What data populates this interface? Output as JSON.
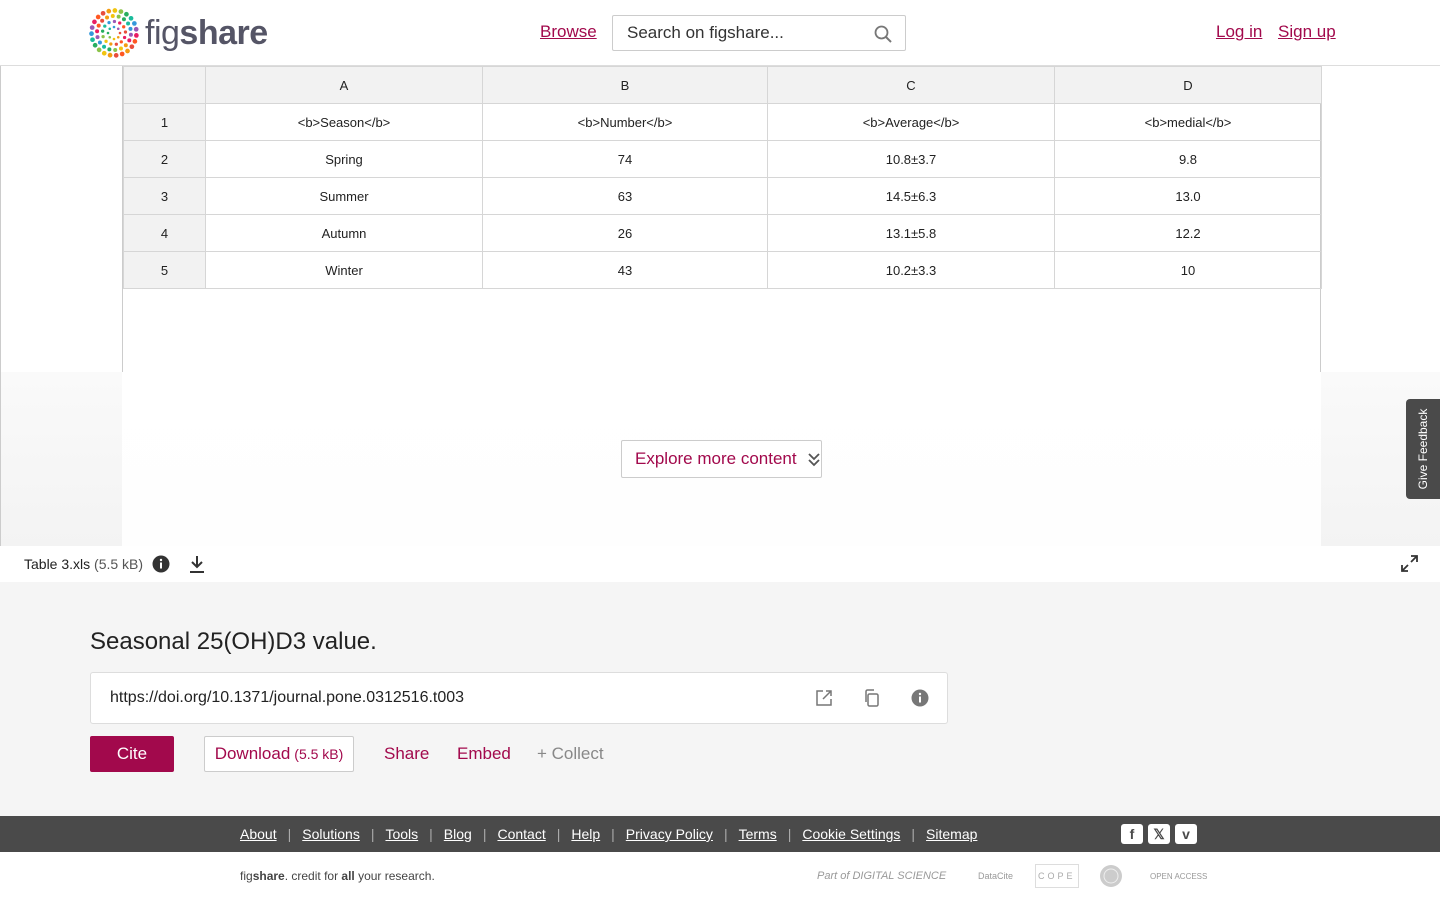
{
  "header": {
    "logo_text_a": "fig",
    "logo_text_b": "share",
    "browse": "Browse",
    "search_placeholder": "Search on figshare...",
    "login": "Log in",
    "signup": "Sign up"
  },
  "sheet": {
    "columns": [
      "A",
      "B",
      "C",
      "D"
    ],
    "rows": [
      {
        "num": "1",
        "cells": [
          "<b>Season</b>",
          "<b>Number</b>",
          "<b>Average</b>",
          "<b>medial</b>"
        ]
      },
      {
        "num": "2",
        "cells": [
          "Spring",
          "74",
          "10.8±3.7",
          "9.8"
        ]
      },
      {
        "num": "3",
        "cells": [
          "Summer",
          "63",
          "14.5±6.3",
          "13.0"
        ]
      },
      {
        "num": "4",
        "cells": [
          "Autumn",
          "26",
          "13.1±5.8",
          "12.2"
        ]
      },
      {
        "num": "5",
        "cells": [
          "Winter",
          "43",
          "10.2±3.3",
          "10"
        ]
      }
    ]
  },
  "explore_label": "Explore more content",
  "file": {
    "name": "Table 3.xls",
    "size": "(5.5 kB)"
  },
  "feedback": "Give Feedback",
  "item": {
    "title": "Seasonal 25(OH)D3 value.",
    "doi": "https://doi.org/10.1371/journal.pone.0312516.t003",
    "cite": "Cite",
    "download": "Download",
    "download_size": "(5.5 kB)",
    "share": "Share",
    "embed": "Embed",
    "collect": "+ Collect"
  },
  "footer": {
    "links": [
      "About",
      "Solutions",
      "Tools",
      "Blog",
      "Contact",
      "Help",
      "Privacy Policy",
      "Terms",
      "Cookie Settings",
      "Sitemap"
    ],
    "social": [
      "facebook-icon",
      "x-icon",
      "vimeo-icon"
    ],
    "tagline_a": "fig",
    "tagline_b": "share",
    "tagline_c": ". credit for ",
    "tagline_d": "all",
    "tagline_e": " your research.",
    "partners": [
      "Part of DIGITAL SCIENCE",
      "DataCite",
      "COPE",
      "seal",
      "OPEN ACCESS"
    ]
  },
  "colors": {
    "brand": "#a2094c",
    "footer_bg": "#4a4a4a"
  }
}
